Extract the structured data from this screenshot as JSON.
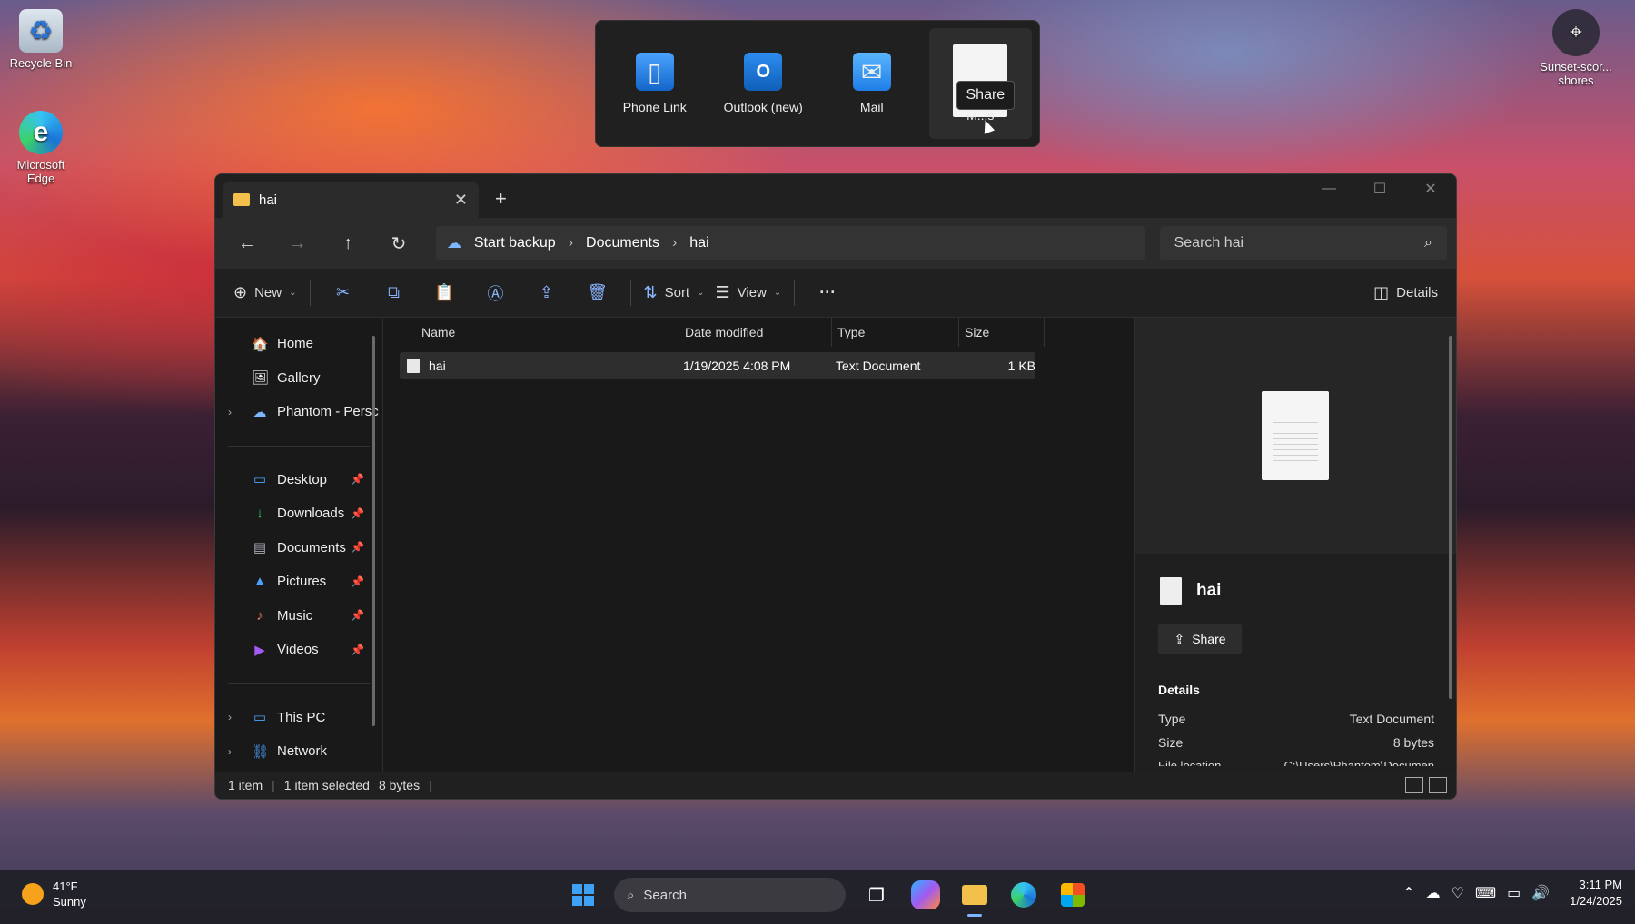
{
  "desktop": {
    "icons": [
      {
        "label": "Recycle Bin",
        "glyph": "♻"
      },
      {
        "label": "Microsoft Edge",
        "glyph": "e"
      }
    ],
    "location_label": "Sunset-scor... shores"
  },
  "share_flyout": {
    "apps": [
      {
        "label": "Phone Link",
        "icon": "phone-link-icon"
      },
      {
        "label": "Outlook (new)",
        "icon": "outlook-icon"
      },
      {
        "label": "Mail",
        "icon": "mail-icon"
      },
      {
        "label": "M...s",
        "icon": "document-icon"
      }
    ],
    "tooltip": "Share"
  },
  "explorer": {
    "tab_title": "hai",
    "breadcrumb": [
      "Start backup",
      "Documents",
      "hai"
    ],
    "search_placeholder": "Search hai",
    "toolbar": {
      "new_label": "New",
      "sort_label": "Sort",
      "view_label": "View",
      "more_label": "···",
      "details_label": "Details"
    },
    "sidebar": [
      {
        "label": "Home",
        "icon": "🏠",
        "pin": false,
        "chev": false
      },
      {
        "label": "Gallery",
        "icon": "🖼",
        "pin": false,
        "chev": false
      },
      {
        "label": "Phantom - Persc",
        "icon": "☁",
        "pin": false,
        "chev": true
      }
    ],
    "sidebar_pinned": [
      {
        "label": "Desktop",
        "icon": "▭"
      },
      {
        "label": "Downloads",
        "icon": "↓"
      },
      {
        "label": "Documents",
        "icon": "▤"
      },
      {
        "label": "Pictures",
        "icon": "▲"
      },
      {
        "label": "Music",
        "icon": "♪"
      },
      {
        "label": "Videos",
        "icon": "▶"
      }
    ],
    "sidebar_bottom": [
      {
        "label": "This PC",
        "icon": "▭"
      },
      {
        "label": "Network",
        "icon": "⛓"
      }
    ],
    "columns": [
      "Name",
      "Date modified",
      "Type",
      "Size"
    ],
    "files": [
      {
        "name": "hai",
        "date": "1/19/2025 4:08 PM",
        "type": "Text Document",
        "size": "1 KB"
      }
    ],
    "preview": {
      "name": "hai",
      "share_label": "Share",
      "details_heading": "Details",
      "rows": [
        {
          "label": "Type",
          "value": "Text Document"
        },
        {
          "label": "Size",
          "value": "8 bytes"
        },
        {
          "label": "File location",
          "value": "C:\\Users\\Phantom\\Documen"
        }
      ]
    },
    "status": {
      "count": "1 item",
      "selected": "1 item selected",
      "size": "8 bytes"
    }
  },
  "taskbar": {
    "weather_temp": "41°F",
    "weather_desc": "Sunny",
    "search_label": "Search",
    "time": "3:11 PM",
    "date": "1/24/2025"
  }
}
